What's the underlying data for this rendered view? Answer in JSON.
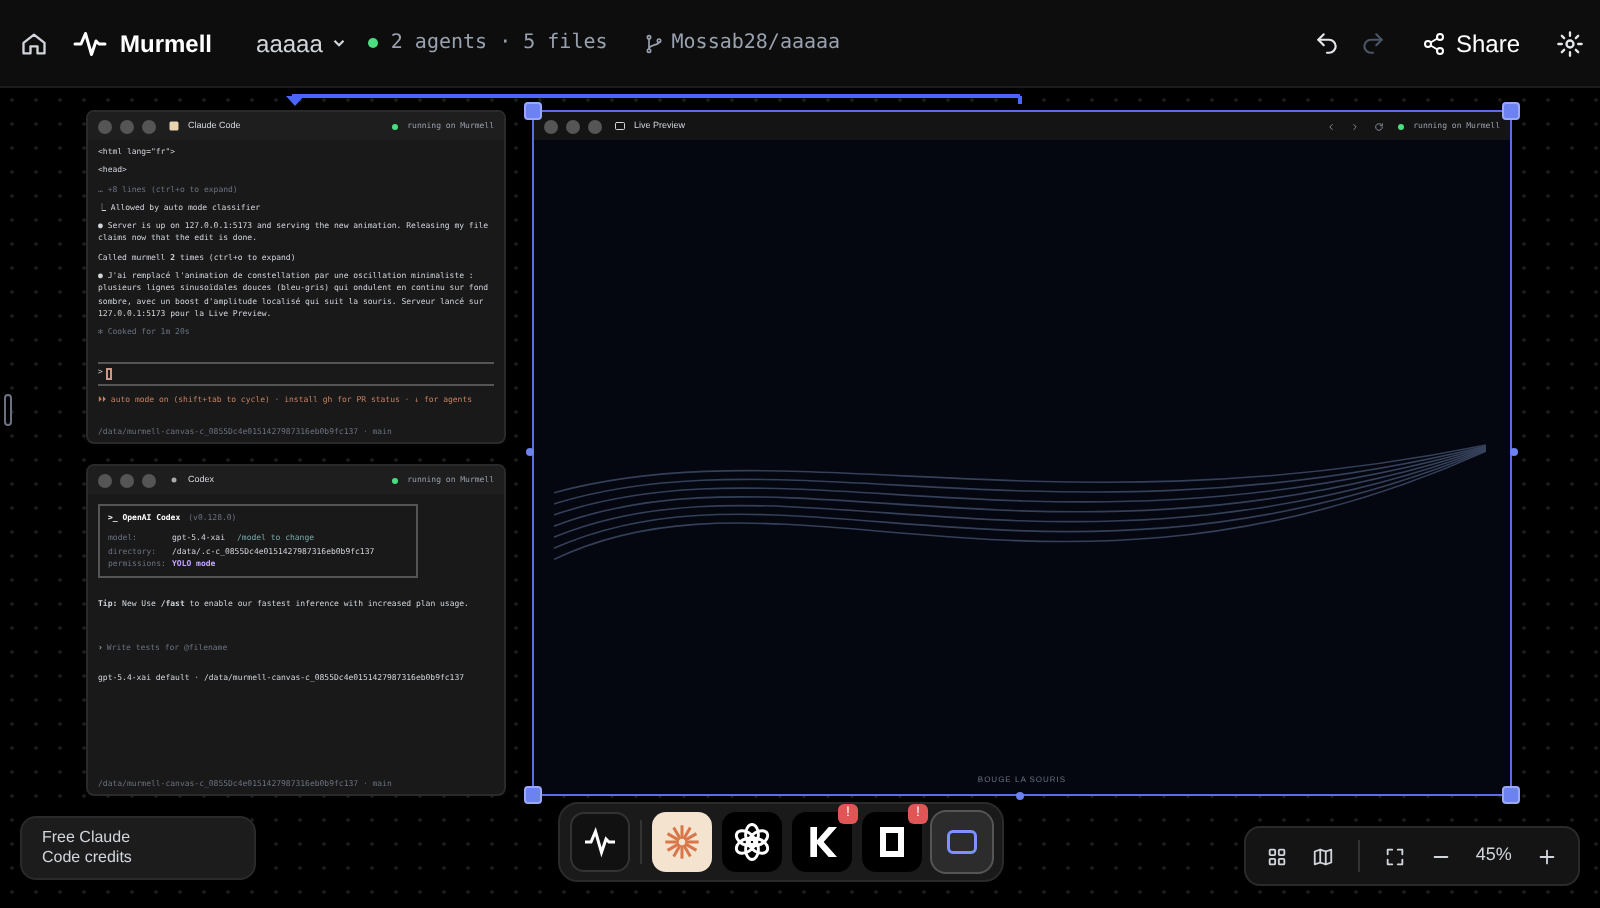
{
  "header": {
    "app_name": "Murmell",
    "workspace": "aaaaa",
    "status": "2 agents · 5 files",
    "repo": "Mossab28/aaaaa",
    "share": "Share",
    "redo_disabled": true
  },
  "panels": [
    {
      "kind": "terminal",
      "title": "Claude Code",
      "status": "running on Murmell",
      "lines": [
        {
          "text": "<html lang=\"fr\">",
          "dim": false
        },
        {
          "text": "<head>",
          "dim": false
        },
        {
          "text": "… +8 lines (ctrl+o to expand)",
          "dim": true
        },
        {
          "text": "⎿  Allowed by auto mode classifier",
          "dim": false
        },
        {
          "text": "● Server is up on 127.0.0.1:5173 and serving the new animation. Releasing my file claims now that the edit is done.",
          "dim": false
        },
        {
          "text": "Called murmell **2** times (ctrl+o to expand)",
          "dim": false
        },
        {
          "text": "● J'ai remplacé l'animation de constellation par une oscillation minimaliste : plusieurs lignes sinusoïdales douces (bleu-gris) qui ondulent en continu sur fond sombre, avec un boost d'amplitude localisé qui suit la souris. Serveur lancé sur 127.0.0.1:5173 pour la Live Preview.",
          "dim": false
        },
        {
          "text": "✻ Cooked for 1m 20s",
          "dim": true
        }
      ],
      "prompt": ">",
      "hint": "⏵⏵ auto mode on (shift+tab to cycle) · install gh for PR status · ↓ for agents",
      "footer": "/data/murmell-canvas-c_0855Dc4e0151427987316eb0b9fc137 · main"
    },
    {
      "kind": "codex",
      "title": "Codex",
      "status": "running on Murmell",
      "banner": {
        "title": ">_  OpenAI Codex",
        "version": "(v0.128.0)",
        "rows": [
          {
            "key": "model:",
            "value": "gpt-5.4-xai",
            "note": "/model to change"
          },
          {
            "key": "directory:",
            "value": "/data/.c-c_0855Dc4e0151427987316eb0b9fc137"
          },
          {
            "key": "permissions:",
            "value": "YOLO mode"
          }
        ]
      },
      "tip": "**Tip:** New Use **/fast** to enable our fastest inference with increased plan usage.",
      "prompt": "›",
      "placeholder": "Write tests for @filename",
      "model_line": "gpt-5.4-xai default · /data/murmell-canvas-c_0855Dc4e0151427987316eb0b9fc137",
      "footer": "/data/murmell-canvas-c_0855Dc4e0151427987316eb0b9fc137 · main"
    }
  ],
  "preview": {
    "title": "Live Preview",
    "status": "running on Murmell",
    "caption": "BOUGE LA SOURIS",
    "selected": true
  },
  "promo": {
    "text": "Free Claude Code credits"
  },
  "dock": [
    {
      "kind": "murmell",
      "selected": false
    },
    {
      "kind": "claude",
      "selected": false
    },
    {
      "kind": "openai",
      "selected": false
    },
    {
      "kind": "k",
      "selected": false,
      "badge": "!"
    },
    {
      "kind": "notion",
      "selected": false,
      "badge": "!"
    },
    {
      "kind": "preview",
      "selected": true
    }
  ],
  "zoom": {
    "value": "45%"
  }
}
